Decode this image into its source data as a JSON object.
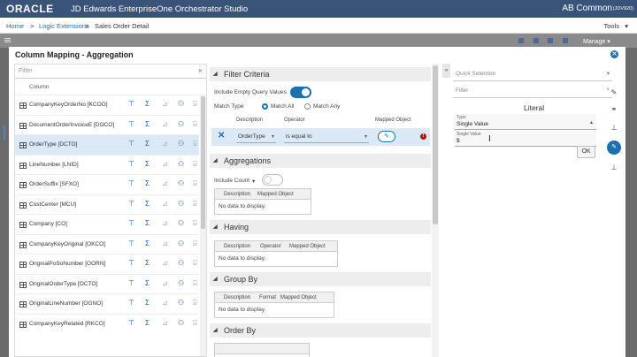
{
  "header": {
    "logo": "ORACLE",
    "app_title": "JD Edwards EnterpriseOne Orchestrator Studio",
    "user": "AB Common",
    "env": "(JDV920)"
  },
  "breadcrumb": {
    "home": "Home",
    "sep": ">",
    "logic": "Logic Extensions",
    "current": "Sales Order Detail",
    "tools": "Tools",
    "tools_caret": "▾"
  },
  "background": {
    "manage": "Manage ▾"
  },
  "dialog": {
    "title": "Column Mapping - Aggregation",
    "close": "✕"
  },
  "left": {
    "filter_placeholder": "Filter",
    "filter_clear": "×",
    "column_header": "Column",
    "action_icons": {
      "group": "⊤",
      "sum": "Σ",
      "avg": "⊿",
      "count": "⚇",
      "more": "⌸"
    },
    "rows": [
      {
        "name": "CompanyKeyOrderNo [KCOO]"
      },
      {
        "name": "DocumentOrderInvoiceE [DOCO]"
      },
      {
        "name": "OrderType [DCTO]"
      },
      {
        "name": "LineNumber [LNID]"
      },
      {
        "name": "OrderSuffix [SFXO]"
      },
      {
        "name": "CostCenter [MCU]"
      },
      {
        "name": "Company [CO]"
      },
      {
        "name": "CompanyKeyOriginal [OKCO]"
      },
      {
        "name": "OriginalPoSoNumber [OORN]"
      },
      {
        "name": "OriginalOrderType [OCTO]"
      },
      {
        "name": "OriginalLineNumber [OGNO]"
      },
      {
        "name": "CompanyKeyRelated [RKCO]"
      }
    ]
  },
  "filter_criteria": {
    "title": "Filter Criteria",
    "include_empty": "Include Empty Query Values",
    "match_type": "Match Type",
    "match_all": "Match All",
    "match_any": "Match Any",
    "cols": {
      "description": "Description",
      "operator": "Operator",
      "mapped_object": "Mapped Object"
    },
    "row": {
      "remove": "✕",
      "description": "OrderType",
      "operator": "is equal to",
      "edit": "✎",
      "error": "!"
    }
  },
  "aggregations": {
    "title": "Aggregations",
    "include_count": "Include Count",
    "include_count_caret": "▾",
    "cols": {
      "description": "Description",
      "mapped_object": "Mapped Object"
    },
    "no_data": "No data to display."
  },
  "having": {
    "title": "Having",
    "cols": {
      "description": "Description",
      "operator": "Operator",
      "mapped_object": "Mapped Object"
    },
    "no_data": "No data to display."
  },
  "group_by": {
    "title": "Group By",
    "cols": {
      "description": "Description",
      "format": "Format",
      "mapped_object": "Mapped Object"
    },
    "no_data": "No data to display."
  },
  "order_by": {
    "title": "Order By"
  },
  "section_caret": "◢",
  "right": {
    "collapse": "»",
    "quick_selection": "Quick Selection",
    "quick_caret": "▾",
    "filter_placeholder": "Filter",
    "filter_clear": "×",
    "literal": "Literal",
    "type_label": "Type",
    "type_value": "Single Value",
    "type_caret": "▴",
    "single_value_label": "Single Value",
    "single_value": "$",
    "cursor": "I",
    "ok": "OK",
    "side_icons": {
      "pin": "✎",
      "link": "⚭",
      "edit": "✎",
      "anchor": "⊥"
    }
  }
}
